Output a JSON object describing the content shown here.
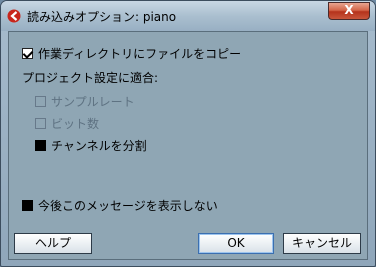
{
  "window": {
    "title": "読み込みオプション: piano",
    "close_label": "X"
  },
  "options": {
    "copy_to_workdir": {
      "label": "作業ディレクトリにファイルをコピー",
      "checked": true
    },
    "adapt_header": "プロジェクト設定に適合:",
    "sample_rate": {
      "label": "サンプルレート",
      "checked": false,
      "enabled": false
    },
    "bit_depth": {
      "label": "ビット数",
      "checked": false,
      "enabled": false
    },
    "split_channels": {
      "label": "チャンネルを分割",
      "checked": true
    },
    "dont_show_again": {
      "label": "今後このメッセージを表示しない",
      "checked": true
    }
  },
  "buttons": {
    "help": "ヘルプ",
    "ok": "OK",
    "cancel": "キャンセル"
  }
}
